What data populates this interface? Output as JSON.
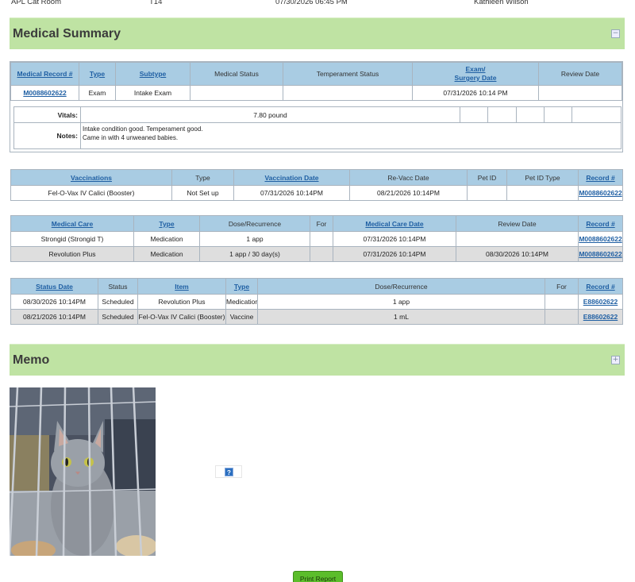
{
  "top_row": {
    "location": "APL Cat Room",
    "kennel": "T14",
    "datetime": "07/30/2026 06:45 PM",
    "person": "Kathleen Wilson"
  },
  "medical_summary": {
    "title": "Medical Summary",
    "toggle": "−",
    "headers": [
      "Medical Record #",
      "Type",
      "Subtype",
      "Medical Status",
      "Temperament Status",
      "Exam/ Surgery Date",
      "Review Date"
    ],
    "header_exam_line1": "Exam/",
    "header_exam_line2": "Surgery Date",
    "row": {
      "record": "M0088602622",
      "type": "Exam",
      "subtype": "Intake Exam",
      "medical_status": "",
      "temperament_status": "",
      "exam_date": "07/31/2026 10:14 PM",
      "review_date": ""
    },
    "vitals_label": "Vitals:",
    "vitals_value": "7.80 pound",
    "notes_label": "Notes:",
    "notes_line1": "Intake condition good. Temperament good.",
    "notes_line2": "Came in with 4 unweaned babies."
  },
  "vaccinations": {
    "headers": [
      "Vaccinations",
      "Type",
      "Vaccination Date",
      "Re-Vacc Date",
      "Pet ID",
      "Pet ID Type",
      "Record #"
    ],
    "rows": [
      {
        "name": "Fel-O-Vax IV Calici (Booster)",
        "type": "Not Set up",
        "date": "07/31/2026 10:14PM",
        "revacc": "08/21/2026 10:14PM",
        "pet_id": "",
        "pet_id_type": "",
        "record": "M0088602622"
      }
    ]
  },
  "medical_care": {
    "headers": [
      "Medical Care",
      "Type",
      "Dose/Recurrence",
      "For",
      "Medical Care Date",
      "Review Date",
      "Record #"
    ],
    "rows": [
      {
        "name": "Strongid (Strongid T)",
        "type": "Medication",
        "dose": "1 app",
        "for": "",
        "date": "07/31/2026 10:14PM",
        "review": "",
        "record": "M0088602622"
      },
      {
        "name": "Revolution Plus",
        "type": "Medication",
        "dose": "1 app / 30 day(s)",
        "for": "",
        "date": "07/31/2026 10:14PM",
        "review": "08/30/2026 10:14PM",
        "record": "M0088602622"
      }
    ]
  },
  "status": {
    "headers": [
      "Status Date",
      "Status",
      "Item",
      "Type",
      "Dose/Recurrence",
      "For",
      "Record #"
    ],
    "rows": [
      {
        "date": "08/30/2026 10:14PM",
        "status": "Scheduled",
        "item": "Revolution Plus",
        "type": "Medication",
        "dose": "1 app",
        "for": "",
        "record": "E88602622"
      },
      {
        "date": "08/21/2026 10:14PM",
        "status": "Scheduled",
        "item": "Fel-O-Vax IV Calici (Booster)",
        "type": "Vaccine",
        "dose": "1 mL",
        "for": "",
        "record": "E88602622"
      }
    ]
  },
  "memo": {
    "title": "Memo",
    "toggle": "+",
    "help": "?"
  },
  "print_button": "Print Report",
  "colors": {
    "section_bar": "#bfe3a3",
    "header_bg": "#a9cce3",
    "link": "#1f5fa3",
    "print_button": "#5bbd2b"
  }
}
